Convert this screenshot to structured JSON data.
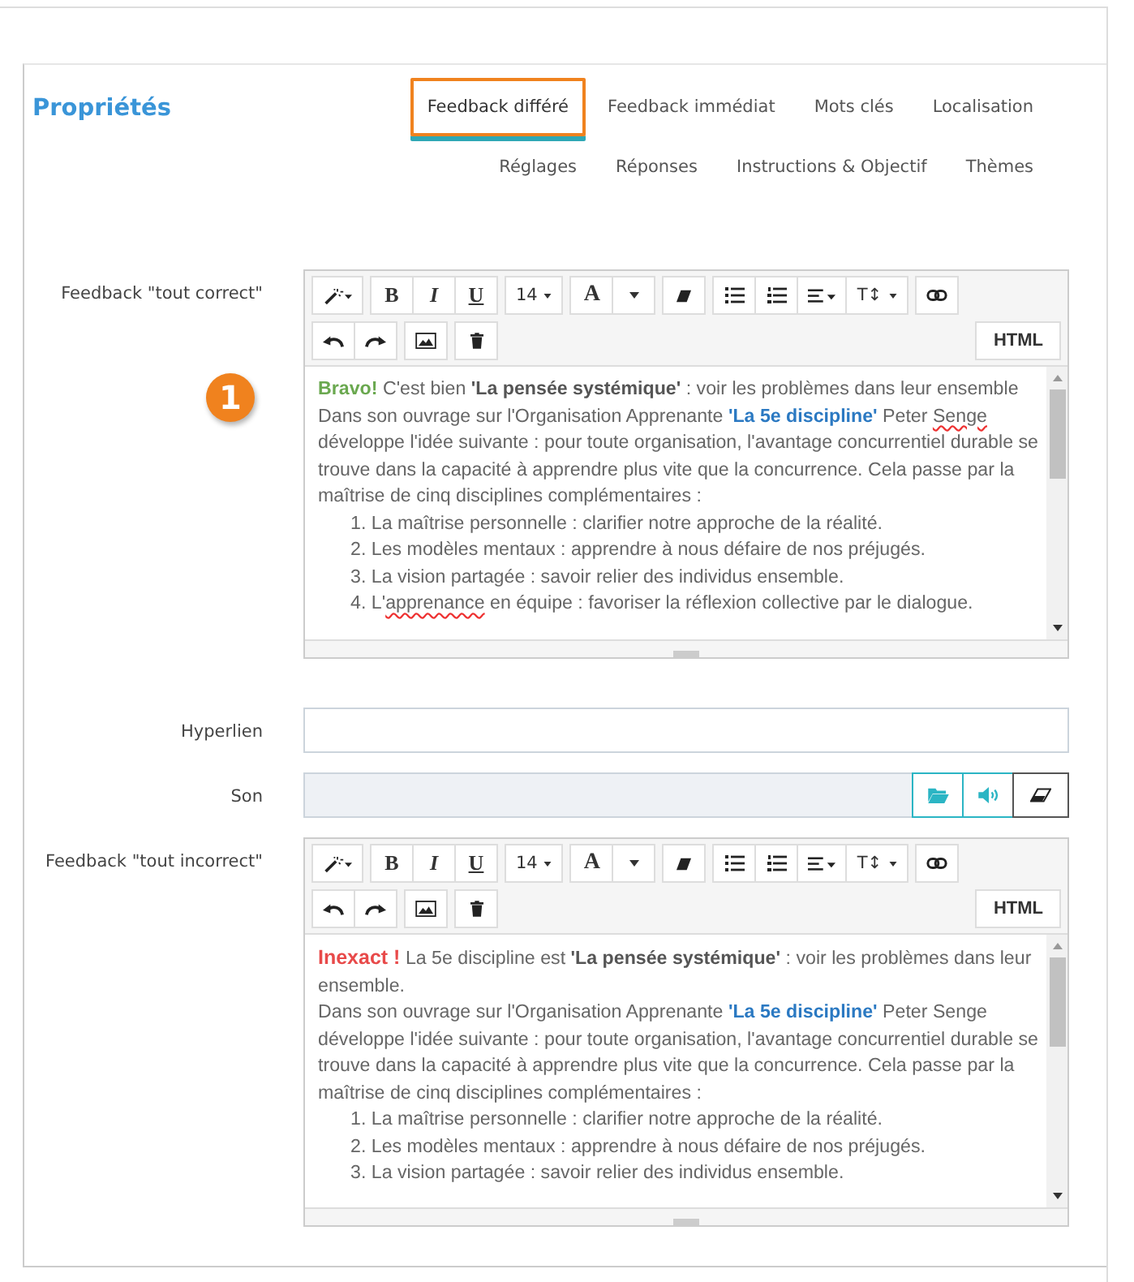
{
  "panel": {
    "title": "Propriétés"
  },
  "tab_rows": [
    {
      "tabs": [
        {
          "label": "Feedback différé",
          "selected": true
        },
        {
          "label": "Feedback immédiat",
          "selected": false
        },
        {
          "label": "Mots clés",
          "selected": false
        },
        {
          "label": "Localisation",
          "selected": false
        }
      ]
    },
    {
      "tabs": [
        {
          "label": "Réglages",
          "selected": false
        },
        {
          "label": "Réponses",
          "selected": false
        },
        {
          "label": "Instructions & Objectif",
          "selected": false
        },
        {
          "label": "Thèmes",
          "selected": false
        }
      ]
    }
  ],
  "callout_badge": "1",
  "fields": [
    {
      "kind": "editor",
      "label": "Feedback \"tout correct\"",
      "toolbar": {
        "rows": [
          [
            [
              {
                "kind": "magic"
              }
            ],
            [
              {
                "kind": "bold",
                "label": "B"
              },
              {
                "kind": "italic",
                "label": "I"
              },
              {
                "kind": "underline",
                "label": "U"
              }
            ],
            [
              {
                "kind": "size",
                "label": "14"
              }
            ],
            [
              {
                "kind": "color",
                "label": "A"
              },
              {
                "kind": "caret"
              }
            ],
            [
              {
                "kind": "eraser"
              }
            ],
            [
              {
                "kind": "ul"
              },
              {
                "kind": "ol"
              },
              {
                "kind": "align"
              },
              {
                "kind": "height",
                "label": "T↕"
              }
            ],
            [
              {
                "kind": "link"
              }
            ]
          ],
          [
            [
              {
                "kind": "undo"
              },
              {
                "kind": "redo"
              }
            ],
            [
              {
                "kind": "image"
              }
            ],
            [
              {
                "kind": "trash"
              }
            ]
          ]
        ],
        "html_label": "HTML"
      },
      "paragraphs": [
        {
          "kind": "text",
          "segments": [
            {
              "kind": "success",
              "text": "Bravo!"
            },
            {
              "kind": "plain",
              "text": " C'est bien "
            },
            {
              "kind": "strong",
              "text": "'La pensée systémique'"
            },
            {
              "kind": "plain",
              "text": " : voir les problèmes dans leur ensemble"
            }
          ]
        },
        {
          "kind": "text",
          "segments": [
            {
              "kind": "plain",
              "text": "Dans son ouvrage sur l'Organisation Apprenante "
            },
            {
              "kind": "title",
              "text": "'La 5e discipline'"
            },
            {
              "kind": "plain",
              "text": " Peter "
            },
            {
              "kind": "misspelled",
              "text": "Senge"
            },
            {
              "kind": "plain",
              "text": " développe l'idée suivante : pour toute organisation, l'avantage concurrentiel durable se trouve dans la capacité à apprendre plus vite que la concurrence. Cela passe par la maîtrise de cinq disciplines complémentaires :"
            }
          ]
        },
        {
          "kind": "item",
          "segments": [
            {
              "kind": "plain",
              "text": "1. La maîtrise personnelle : clarifier notre approche de la réalité."
            }
          ]
        },
        {
          "kind": "item",
          "segments": [
            {
              "kind": "plain",
              "text": "2. Les modèles mentaux : apprendre à nous défaire de nos préjugés."
            }
          ]
        },
        {
          "kind": "item",
          "segments": [
            {
              "kind": "plain",
              "text": "3. La vision partagée : savoir relier des individus ensemble."
            }
          ]
        },
        {
          "kind": "item",
          "segments": [
            {
              "kind": "plain",
              "text": "4. L'"
            },
            {
              "kind": "misspelled",
              "text": "apprenance"
            },
            {
              "kind": "plain",
              "text": " en équipe : favoriser la réflexion collective par le dialogue."
            }
          ]
        }
      ]
    },
    {
      "kind": "input",
      "label": "Hyperlien"
    },
    {
      "kind": "sound",
      "label": "Son"
    },
    {
      "kind": "editor",
      "label": "Feedback \"tout incorrect\"",
      "toolbar": {
        "rows": [
          [
            [
              {
                "kind": "magic"
              }
            ],
            [
              {
                "kind": "bold",
                "label": "B"
              },
              {
                "kind": "italic",
                "label": "I"
              },
              {
                "kind": "underline",
                "label": "U"
              }
            ],
            [
              {
                "kind": "size",
                "label": "14"
              }
            ],
            [
              {
                "kind": "color",
                "label": "A"
              },
              {
                "kind": "caret"
              }
            ],
            [
              {
                "kind": "eraser"
              }
            ],
            [
              {
                "kind": "ul"
              },
              {
                "kind": "ol"
              },
              {
                "kind": "align"
              },
              {
                "kind": "height",
                "label": "T↕"
              }
            ],
            [
              {
                "kind": "link"
              }
            ]
          ],
          [
            [
              {
                "kind": "undo"
              },
              {
                "kind": "redo"
              }
            ],
            [
              {
                "kind": "image"
              }
            ],
            [
              {
                "kind": "trash"
              }
            ]
          ]
        ],
        "html_label": "HTML"
      },
      "paragraphs": [
        {
          "kind": "text",
          "segments": [
            {
              "kind": "error",
              "text": "Inexact !"
            },
            {
              "kind": "plain",
              "text": " La 5e discipline est "
            },
            {
              "kind": "strong",
              "text": "'La pensée systémique'"
            },
            {
              "kind": "plain",
              "text": " : voir les problèmes dans leur ensemble."
            }
          ]
        },
        {
          "kind": "text",
          "segments": [
            {
              "kind": "plain",
              "text": "Dans son ouvrage sur l'Organisation Apprenante "
            },
            {
              "kind": "title",
              "text": "'La 5e discipline'"
            },
            {
              "kind": "plain",
              "text": " Peter Senge développe l'idée suivante : pour toute organisation, l'avantage concurrentiel durable se trouve dans la capacité à apprendre plus vite que la concurrence. Cela passe par la maîtrise de cinq disciplines complémentaires :"
            }
          ]
        },
        {
          "kind": "item",
          "segments": [
            {
              "kind": "plain",
              "text": "1. La maîtrise personnelle : clarifier notre approche de la réalité."
            }
          ]
        },
        {
          "kind": "item",
          "segments": [
            {
              "kind": "plain",
              "text": "2. Les modèles mentaux : apprendre à nous défaire de nos préjugés."
            }
          ]
        },
        {
          "kind": "item",
          "segments": [
            {
              "kind": "plain",
              "text": "3. La vision partagée : savoir relier des individus ensemble."
            }
          ]
        }
      ]
    }
  ]
}
